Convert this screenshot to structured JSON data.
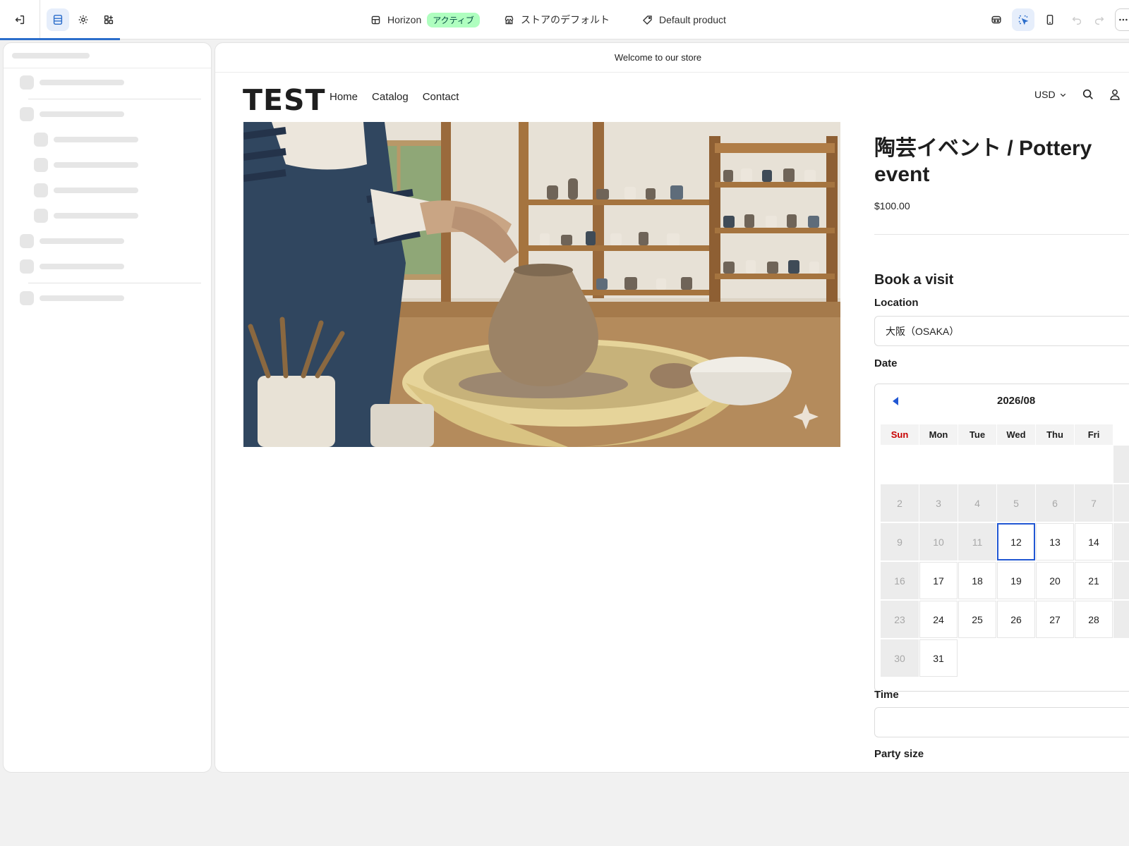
{
  "toolbar": {
    "theme_name": "Horizon",
    "theme_status": "アクティブ",
    "store_name": "ストアのデフォルト",
    "template_name": "Default product"
  },
  "store": {
    "announcement": "Welcome to our store",
    "logo": "TEST",
    "nav": [
      "Home",
      "Catalog",
      "Contact"
    ],
    "currency": "USD"
  },
  "product": {
    "title": "陶芸イベント / Pottery event",
    "price": "$100.00",
    "booking_heading": "Book a visit",
    "location_label": "Location",
    "location_value": "大阪（OSAKA）",
    "date_label": "Date",
    "time_label": "Time",
    "time_value": "",
    "party_label": "Party size"
  },
  "calendar": {
    "month": "2026/08",
    "weekdays": [
      "Sun",
      "Mon",
      "Tue",
      "Wed",
      "Thu",
      "Fri"
    ],
    "weeks": [
      [
        "",
        "",
        "",
        "",
        "",
        ""
      ],
      [
        "2",
        "3",
        "4",
        "5",
        "6",
        "7"
      ],
      [
        "9",
        "10",
        "11",
        "12",
        "13",
        "14"
      ],
      [
        "16",
        "17",
        "18",
        "19",
        "20",
        "21"
      ],
      [
        "23",
        "24",
        "25",
        "26",
        "27",
        "28"
      ],
      [
        "30",
        "31",
        "",
        "",
        "",
        ""
      ]
    ],
    "disabled_days": [
      "2",
      "3",
      "4",
      "5",
      "6",
      "7",
      "9",
      "10",
      "11",
      "16",
      "23",
      "30"
    ],
    "selected_day": "12",
    "accent_color": "#2157d3",
    "sunday_color": "#c80000"
  },
  "colors": {
    "badge_bg": "#affebf",
    "badge_text": "#014b40",
    "progress": "#2c6ecb"
  }
}
